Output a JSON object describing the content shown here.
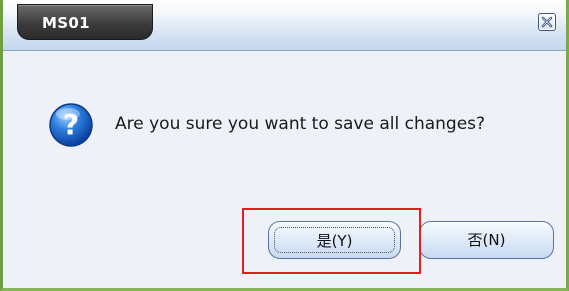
{
  "window": {
    "title": "MS01"
  },
  "dialog": {
    "message": "Are you sure you want to save all changes?",
    "icon": "question-icon"
  },
  "buttons": {
    "yes_label": "是(Y)",
    "no_label": "否(N)"
  },
  "colors": {
    "highlight": "#e02020",
    "title_tab": "#3c3c3c",
    "window_border": "#6f9f41"
  }
}
